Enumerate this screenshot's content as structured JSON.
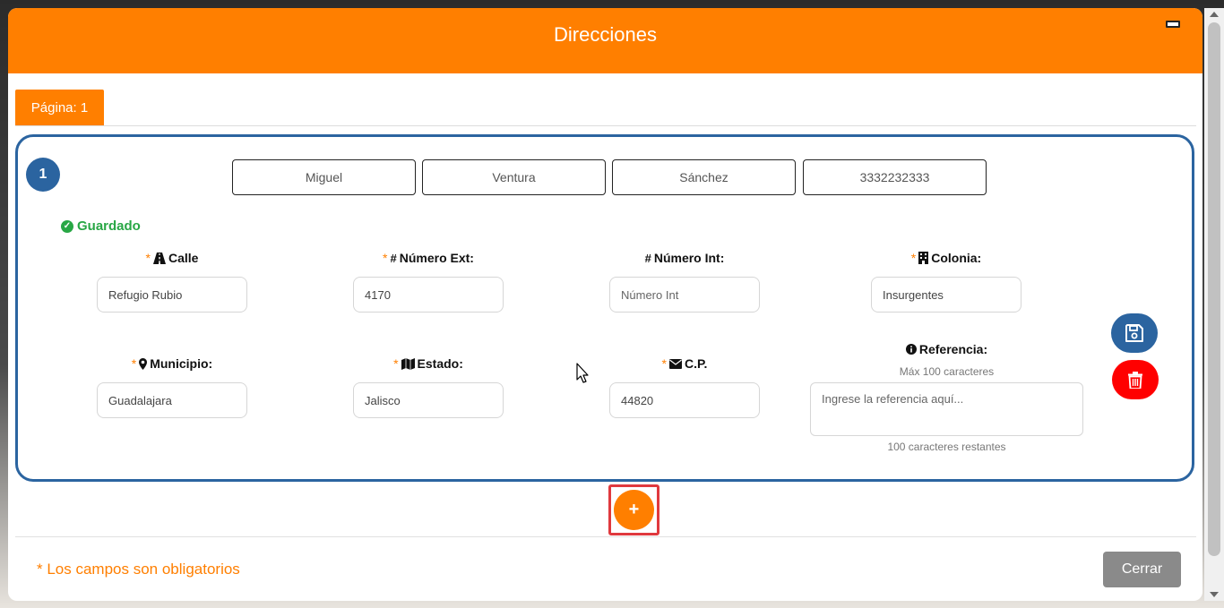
{
  "modal": {
    "title": "Direcciones",
    "tab_label": "Página: 1"
  },
  "card": {
    "number": "1",
    "person": [
      "Miguel",
      "Ventura",
      "Sánchez",
      "3332232333"
    ],
    "status": "Guardado"
  },
  "fields": {
    "calle": {
      "label": "Calle",
      "value": "Refugio Rubio",
      "required": "*"
    },
    "numero_ext": {
      "label": "Número Ext:",
      "value": "4170",
      "required": "*"
    },
    "numero_int": {
      "label": "Número Int:",
      "placeholder": "Número Int"
    },
    "colonia": {
      "label": "Colonia:",
      "value": "Insurgentes",
      "required": "*"
    },
    "municipio": {
      "label": "Municipio:",
      "value": "Guadalajara",
      "required": "*"
    },
    "estado": {
      "label": "Estado:",
      "value": "Jalisco",
      "required": "*"
    },
    "cp": {
      "label": "C.P.",
      "value": "44820",
      "required": "*"
    },
    "referencia": {
      "label": "Referencia:",
      "max_hint": "Máx 100 caracteres",
      "placeholder": "Ingrese la referencia aquí...",
      "remaining": "100 caracteres restantes"
    }
  },
  "buttons": {
    "add": "+",
    "close": "Cerrar"
  },
  "footer": {
    "required_note": "* Los campos son obligatorios"
  },
  "colors": {
    "brand_orange": "#ff7f00",
    "card_blue": "#2b64a0",
    "saved_green": "#28a745",
    "delete_red": "#ff0000",
    "close_gray": "#8a8a8a"
  },
  "icons": {
    "calle": "road-icon",
    "numero_ext": "hash-icon",
    "numero_int": "hash-icon",
    "colonia": "building-icon",
    "municipio": "map-marker-icon",
    "estado": "map-icon",
    "cp": "envelope-icon",
    "referencia": "info-icon",
    "save": "floppy-disk-icon",
    "delete": "trash-icon"
  }
}
